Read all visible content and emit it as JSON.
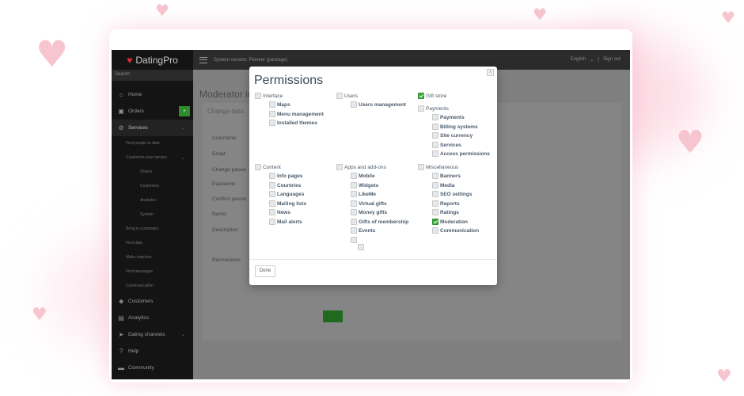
{
  "app": {
    "logo_text": "DatingPro",
    "search_placeholder": "Search",
    "topbar_text": "System version: Pioneer (package)",
    "language": "English",
    "signout": "Sign out"
  },
  "sidebar": {
    "items": [
      {
        "label": "Home",
        "icon": "home-icon"
      },
      {
        "label": "Orders",
        "icon": "orders-icon"
      },
      {
        "label": "Services",
        "icon": "gear-icon"
      },
      {
        "label": "Find people to date"
      },
      {
        "label": "Customize your service"
      },
      {
        "label": "Orders"
      },
      {
        "label": "Customers"
      },
      {
        "label": "Analytics"
      },
      {
        "label": "System"
      },
      {
        "label": "Bring in customers"
      },
      {
        "label": "Find data"
      },
      {
        "label": "Make matches"
      },
      {
        "label": "Find messages"
      },
      {
        "label": "Communication"
      },
      {
        "label": "Customers",
        "icon": "users-icon"
      },
      {
        "label": "Analytics",
        "icon": "chart-icon"
      },
      {
        "label": "Dating channels",
        "icon": "channels-icon"
      },
      {
        "label": "Help",
        "icon": "help-icon"
      },
      {
        "label": "Community",
        "icon": "chat-icon"
      }
    ]
  },
  "page": {
    "title": "Moderator in",
    "tab": "Change data",
    "fields": [
      "Username:",
      "Email:",
      "Change passw",
      "Password:",
      "Confirm passw",
      "Name:",
      "Description:",
      "Permissions:"
    ]
  },
  "modal": {
    "title": "Permissions",
    "close": "×",
    "done": "Done",
    "groups": {
      "interface": {
        "label": "Interface",
        "checked": false,
        "children": [
          {
            "label": "Maps",
            "checked": false
          },
          {
            "label": "Menu management",
            "checked": false
          },
          {
            "label": "Installed themes",
            "checked": false
          }
        ]
      },
      "users": {
        "label": "Users",
        "checked": false,
        "children": [
          {
            "label": "Users management",
            "checked": false
          }
        ]
      },
      "gift_store": {
        "label": "Gift store",
        "checked": true
      },
      "payments": {
        "label": "Payments",
        "checked": false,
        "children": [
          {
            "label": "Payments",
            "checked": false
          },
          {
            "label": "Billing systems",
            "checked": false
          },
          {
            "label": "Site currency",
            "checked": false
          },
          {
            "label": "Services",
            "checked": false
          },
          {
            "label": "Access permissions",
            "checked": false
          }
        ]
      },
      "content": {
        "label": "Content",
        "checked": false,
        "children": [
          {
            "label": "Info pages",
            "checked": false
          },
          {
            "label": "Countries",
            "checked": false
          },
          {
            "label": "Languages",
            "checked": false
          },
          {
            "label": "Mailing lists",
            "checked": false
          },
          {
            "label": "News",
            "checked": false
          },
          {
            "label": "Mail alerts",
            "checked": false
          }
        ]
      },
      "apps": {
        "label": "Apps and add-ons",
        "checked": false,
        "children": [
          {
            "label": "Mobile",
            "checked": false
          },
          {
            "label": "Widgets",
            "checked": false
          },
          {
            "label": "LikeMe",
            "checked": false
          },
          {
            "label": "Virtual gifts",
            "checked": false
          },
          {
            "label": "Money gifts",
            "checked": false
          },
          {
            "label": "Gifts of membership",
            "checked": false
          },
          {
            "label": "Events",
            "checked": false
          }
        ]
      },
      "misc": {
        "label": "Miscellaneous",
        "checked": false,
        "children": [
          {
            "label": "Banners",
            "checked": false
          },
          {
            "label": "Media",
            "checked": false
          },
          {
            "label": "SEO settings",
            "checked": false
          },
          {
            "label": "Reports",
            "checked": false
          },
          {
            "label": "Ratings",
            "checked": false
          },
          {
            "label": "Moderation",
            "checked": true
          },
          {
            "label": "Communication",
            "checked": false
          }
        ]
      }
    }
  },
  "colors": {
    "accent_green": "#3aa83a",
    "logo_red": "#e02a3a",
    "heart_pink": "#f7c5cf"
  }
}
